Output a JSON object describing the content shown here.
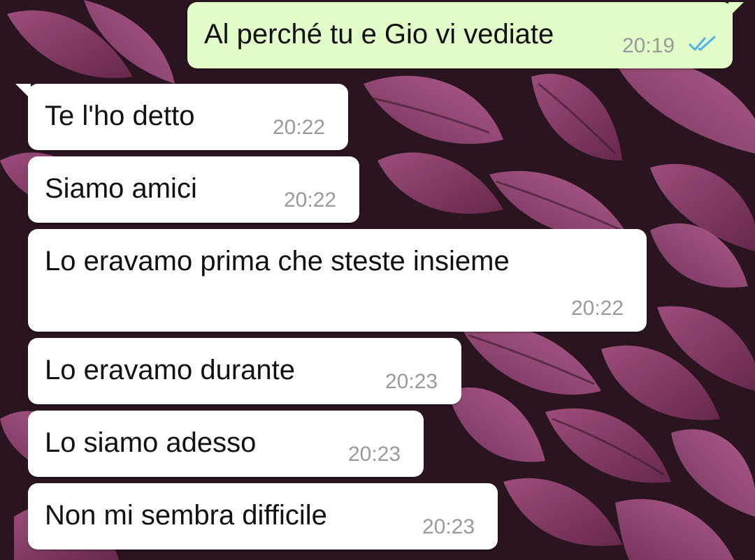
{
  "conversation": {
    "sent": [
      {
        "text": "Al perché tu e Gio vi vediate",
        "time": "20:19",
        "status_icon": "double-check-read-icon"
      }
    ],
    "received": [
      {
        "text": "Te l'ho detto",
        "time": "20:22"
      },
      {
        "text": "Siamo amici",
        "time": "20:22"
      },
      {
        "text": "Lo eravamo prima che steste insieme",
        "time": "20:22"
      },
      {
        "text": "Lo eravamo durante",
        "time": "20:23"
      },
      {
        "text": "Lo siamo adesso",
        "time": "20:23"
      },
      {
        "text": "Non mi sembra difficile",
        "time": "20:23"
      }
    ]
  },
  "colors": {
    "incoming_bubble": "#ffffff",
    "outgoing_bubble": "#e1fcc9",
    "read_ticks": "#4fb3e8",
    "timestamp": "#9a9a9a",
    "wallpaper": "#2a1420",
    "leaf": "#8a3a66"
  }
}
